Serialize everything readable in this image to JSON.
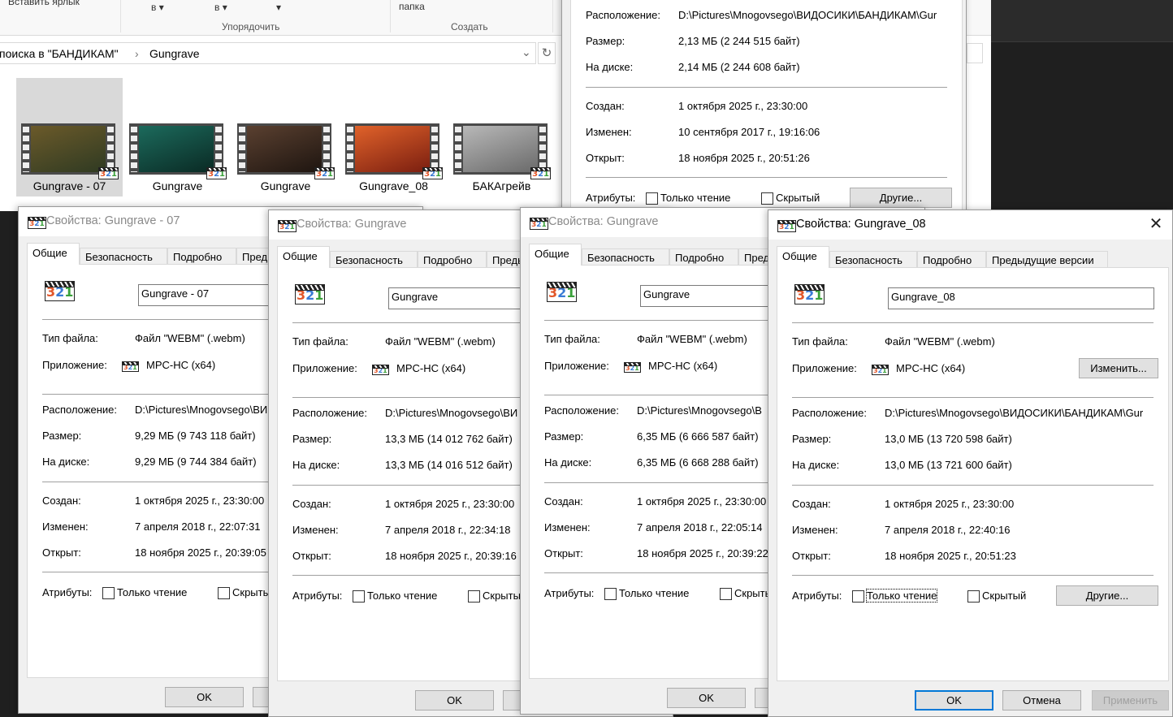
{
  "explorer": {
    "ribbon": {
      "paste_shortcut": "Вставить ярлык",
      "sort_btn_1": "в ▾",
      "sort_btn_2": "в ▾",
      "sort_btn_3": "▾",
      "organize_group": "Упорядочить",
      "new_folder": "папка",
      "create_group": "Создать"
    },
    "breadcrumb": {
      "parent": "поиска в \"БАНДИКАМ\"",
      "separator": "›",
      "current": "Gungrave"
    },
    "files": [
      {
        "name": "Gungrave - 07",
        "selected": true,
        "colors": [
          "#6b5a2a",
          "#2f3a22"
        ]
      },
      {
        "name": "Gungrave",
        "selected": false,
        "colors": [
          "#1c6a5c",
          "#0a2a24"
        ]
      },
      {
        "name": "Gungrave",
        "selected": false,
        "colors": [
          "#5a4030",
          "#1e1510"
        ]
      },
      {
        "name": "Gungrave_08",
        "selected": false,
        "colors": [
          "#e0622a",
          "#7a1e10"
        ]
      },
      {
        "name": "БАКАгрейв",
        "selected": false,
        "colors": [
          "#b8b8b8",
          "#6a6a6a"
        ]
      }
    ]
  },
  "labels": {
    "tabs": [
      "Общие",
      "Безопасность",
      "Подробно",
      "Предыдущие версии"
    ],
    "type": "Тип файла:",
    "app": "Приложение:",
    "location": "Расположение:",
    "size": "Размер:",
    "disk": "На диске:",
    "created": "Создан:",
    "modified": "Изменен:",
    "opened": "Открыт:",
    "attributes": "Атрибуты:",
    "readonly": "Только чтение",
    "hidden": "Скрытый",
    "change": "Изменить...",
    "other": "Другие...",
    "ok": "OK",
    "cancel": "Отмена",
    "apply": "Применить"
  },
  "dialogs": [
    {
      "title": "Свойства: Gungrave_08 (background)",
      "name": "",
      "type": "",
      "app": "",
      "location": "D:\\Pictures\\Mnogovsego\\ВИДОСИКИ\\БАНДИКАМ\\Gur",
      "size": "2,13 МБ (2 244 515 байт)",
      "disk": "2,14 МБ (2 244 608 байт)",
      "created": "1 октября 2025 г., 23:30:00",
      "modified": "10 сентября 2017 г., 19:16:06",
      "opened": "18 ноября 2025 г., 20:51:26",
      "active": false
    },
    {
      "title": "Свойства: Gungrave - 07",
      "name": "Gungrave - 07",
      "type": "Файл \"WEBM\" (.webm)",
      "app": "MPC-HC (x64)",
      "location": "D:\\Pictures\\Mnogovsego\\ВИ",
      "size": "9,29 МБ (9 743 118 байт)",
      "disk": "9,29 МБ (9 744 384 байт)",
      "created": "1 октября 2025 г., 23:30:00",
      "modified": "7 апреля 2018 г., 22:07:31",
      "opened": "18 ноября 2025 г., 20:39:05",
      "active": false
    },
    {
      "title": "Свойства: Gungrave",
      "name": "Gungrave",
      "type": "Файл \"WEBM\" (.webm)",
      "app": "MPC-HC (x64)",
      "location": "D:\\Pictures\\Mnogovsego\\ВИ",
      "size": "13,3 МБ (14 012 762 байт)",
      "disk": "13,3 МБ (14 016 512 байт)",
      "created": "1 октября 2025 г., 23:30:00",
      "modified": "7 апреля 2018 г., 22:34:18",
      "opened": "18 ноября 2025 г., 20:39:16",
      "active": false
    },
    {
      "title": "Свойства: Gungrave",
      "name": "Gungrave",
      "type": "Файл \"WEBM\" (.webm)",
      "app": "MPC-HC (x64)",
      "location": "D:\\Pictures\\Mnogovsego\\В",
      "size": "6,35 МБ (6 666 587 байт)",
      "disk": "6,35 МБ (6 668 288 байт)",
      "created": "1 октября 2025 г., 23:30:00",
      "modified": "7 апреля 2018 г., 22:05:14",
      "opened": "18 ноября 2025 г., 20:39:22",
      "active": false
    },
    {
      "title": "Свойства: Gungrave_08",
      "name": "Gungrave_08",
      "type": "Файл \"WEBM\" (.webm)",
      "app": "MPC-HC (x64)",
      "location": "D:\\Pictures\\Mnogovsego\\ВИДОСИКИ\\БАНДИКАМ\\Gur",
      "size": "13,0 МБ (13 720 598 байт)",
      "disk": "13,0 МБ (13 721 600 байт)",
      "created": "1 октября 2025 г., 23:30:00",
      "modified": "7 апреля 2018 г., 22:40:16",
      "opened": "18 ноября 2025 г., 20:51:23",
      "active": true
    }
  ]
}
